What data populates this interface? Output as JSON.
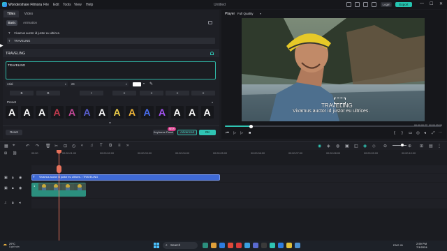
{
  "titlebar": {
    "app_name": "Wondershare Filmora",
    "menu": [
      "File",
      "Edit",
      "Tools",
      "View",
      "Help"
    ],
    "document_title": "Untitled",
    "login_label": "Login",
    "export_label": "Export",
    "window_controls": [
      "—",
      "☐",
      "✕"
    ]
  },
  "left_panel": {
    "tabs": [
      "Titles",
      "Video"
    ],
    "subtabs": [
      "Basic",
      "Animation"
    ],
    "text_rows": [
      "Vivamus auctor id justor eu ultrices.",
      "TRAVELING"
    ],
    "section_label": "TRAVELING",
    "textarea_value": "TRAVELING",
    "font": "Arial",
    "size": "24",
    "style_buttons": [
      "B",
      "B",
      "I",
      "≡",
      "≡",
      "≡",
      "≡"
    ],
    "preset_label": "Preset",
    "presets": [
      {
        "glyph": "A",
        "color": "#ffffff"
      },
      {
        "glyph": "A",
        "color": "#ffffff"
      },
      {
        "glyph": "A",
        "color": "#ffffff"
      },
      {
        "glyph": "A",
        "color": "#c23a4e"
      },
      {
        "glyph": "A",
        "color": "#c64a9a"
      },
      {
        "glyph": "A",
        "color": "#5a5fd0"
      },
      {
        "glyph": "A",
        "color": "#ffffff"
      },
      {
        "glyph": "A",
        "color": "#f0d04a"
      },
      {
        "glyph": "A",
        "color": "#f2b63a"
      },
      {
        "glyph": "A",
        "color": "#4a6ef0"
      },
      {
        "glyph": "A",
        "color": "#a855f7"
      },
      {
        "glyph": "A",
        "color": "#ffffff"
      },
      {
        "glyph": "A",
        "color": "#ffffff"
      },
      {
        "glyph": "A",
        "color": "#ffffff"
      }
    ],
    "reset_label": "Reset",
    "keyframe_label": "Keyframe Panel",
    "new_badge": "NEW",
    "advanced_label": "Advanced",
    "ok_label": "OK"
  },
  "player": {
    "label": "Player",
    "quality": "Full Quality",
    "subtitle_title": "TRAVELING",
    "subtitle_line": "Vivamus auctor id justor eu ultrices.",
    "progress": 0.12,
    "time_current": "00:00:00:22",
    "time_total": "00:00:05:00",
    "controls": [
      "⏮",
      "▷",
      "▷",
      "■"
    ]
  },
  "timeline": {
    "ruler_ticks": [
      "00:00",
      "00:00:01:00",
      "00:00:02:00",
      "00:00:03:00",
      "00:00:04:00",
      "00:00:05:00",
      "00:00:06:00",
      "00:00:07:00",
      "00:00:08:00",
      "00:00:09:00",
      "00:00:10:00"
    ],
    "title_clip_label": "Vivamus auctor id justor eu ultrices. / TRAVELING",
    "video_clip_label": "1"
  },
  "taskbar": {
    "temperature": "29°C",
    "weather": "Light rain",
    "search_placeholder": "Search",
    "tray": "ENG IN",
    "time": "2:59 PM",
    "date": "7/1/2024"
  },
  "colors": {
    "accent": "#2fc4b3",
    "title_clip": "#3f6ad6",
    "video_clip": "#2b8f7e",
    "playhead": "#e8725b"
  }
}
